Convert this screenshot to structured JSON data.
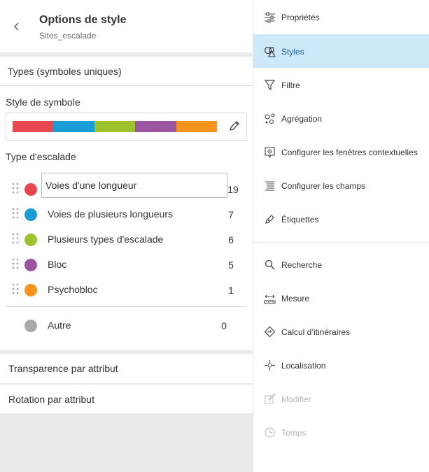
{
  "header": {
    "title": "Options de style",
    "subtitle": "Sites_escalade"
  },
  "types_section": {
    "heading": "Types (symboles uniques)",
    "symbol_style_label": "Style de symbole",
    "ramp_colors": [
      "#e8474f",
      "#1a9dd4",
      "#9ec22e",
      "#9c55a0",
      "#f7941d"
    ],
    "field_label": "Type d'escalade",
    "categories": [
      {
        "label": "Voies d'une longueur",
        "count": "19",
        "color": "#e8474f"
      },
      {
        "label": "Voies de plusieurs longueurs",
        "count": "7",
        "color": "#1a9dd4"
      },
      {
        "label": "Plusieurs types d'escalade",
        "count": "6",
        "color": "#9ec22e"
      },
      {
        "label": "Bloc",
        "count": "5",
        "color": "#9c55a0"
      },
      {
        "label": "Psychobloc",
        "count": "1",
        "color": "#f7941d"
      }
    ],
    "other": {
      "label": "Autre",
      "count": "0",
      "color": "#a9a9a9"
    }
  },
  "transparency_label": "Transparence par attribut",
  "rotation_label": "Rotation par attribut",
  "right_panel": {
    "items": [
      {
        "label": "Propriétés",
        "icon": "sliders-icon",
        "state": "normal"
      },
      {
        "label": "Styles",
        "icon": "styles-icon",
        "state": "active"
      },
      {
        "label": "Filtre",
        "icon": "filter-icon",
        "state": "normal"
      },
      {
        "label": "Agrégation",
        "icon": "aggregation-icon",
        "state": "normal"
      },
      {
        "label": "Configurer les fenêtres contextuelles",
        "icon": "popup-icon",
        "state": "normal"
      },
      {
        "label": "Configurer les champs",
        "icon": "fields-icon",
        "state": "normal"
      },
      {
        "label": "Étiquettes",
        "icon": "label-icon",
        "state": "normal"
      },
      {
        "label": "Recherche",
        "icon": "search-icon",
        "state": "normal"
      },
      {
        "label": "Mesure",
        "icon": "measure-icon",
        "state": "normal"
      },
      {
        "label": "Calcul d’itinéraires",
        "icon": "directions-icon",
        "state": "normal"
      },
      {
        "label": "Localisation",
        "icon": "locate-icon",
        "state": "normal"
      },
      {
        "label": "Modifier",
        "icon": "edit-icon",
        "state": "disabled"
      },
      {
        "label": "Temps",
        "icon": "clock-icon",
        "state": "disabled"
      }
    ],
    "active_color": "#cde8f9"
  }
}
